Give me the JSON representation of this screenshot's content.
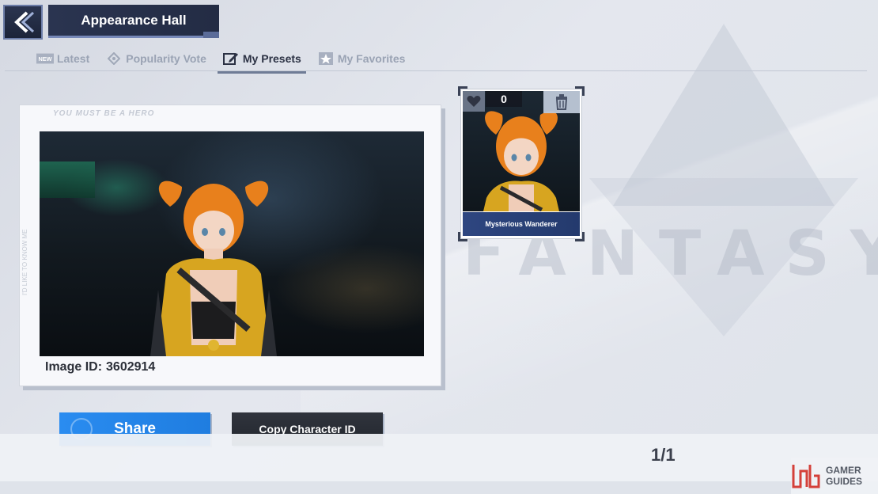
{
  "header": {
    "title": "Appearance Hall"
  },
  "tabs": [
    {
      "label": "Latest",
      "icon": "new-badge-icon"
    },
    {
      "label": "Popularity Vote",
      "icon": "vote-icon"
    },
    {
      "label": "My Presets",
      "icon": "edit-icon",
      "active": true
    },
    {
      "label": "My Favorites",
      "icon": "star-icon"
    }
  ],
  "preview": {
    "image_id_label": "Image ID:",
    "image_id": "3602914",
    "card_tag": "YOU MUST BE A HERO",
    "side_text": "I'D LIKE TO KNOW ME"
  },
  "preset": {
    "likes": "0",
    "name": "Mysterious Wanderer"
  },
  "actions": {
    "share_label": "Share",
    "copy_label": "Copy Character ID"
  },
  "pager": {
    "text": "1/1"
  },
  "watermark": {
    "text": "FANTASY"
  },
  "brand": {
    "line1": "GAMER",
    "line2": "GUIDES"
  },
  "colors": {
    "share_blue": "#2a8cf0",
    "dark_button": "#23272e",
    "header_navy": "#232c44",
    "preset_blue": "#2e4680"
  }
}
